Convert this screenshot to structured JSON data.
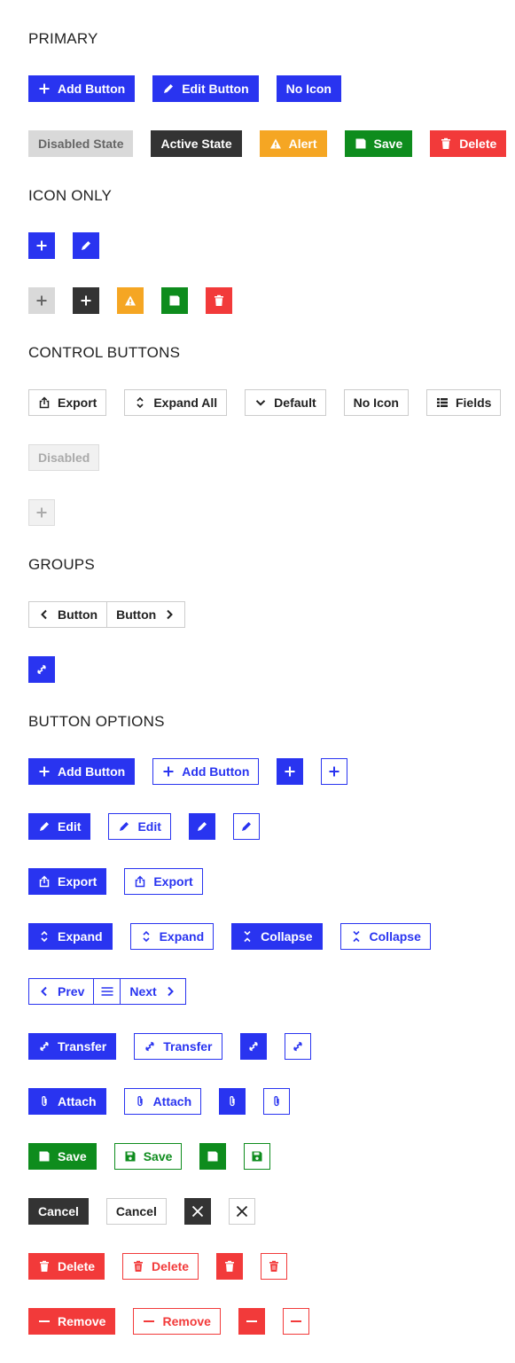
{
  "colors": {
    "primary": "#2934f0",
    "disabled": "#d9d9d9",
    "active": "#333333",
    "alert": "#f5a623",
    "save": "#0e8c1d",
    "delete": "#f23a3a"
  },
  "sections": {
    "primary": "PRIMARY",
    "icon_only": "ICON ONLY",
    "control_buttons": "CONTROL BUTTONS",
    "groups": "GROUPS",
    "button_options": "BUTTON OPTIONS"
  },
  "primary": {
    "add_button": "Add Button",
    "edit_button": "Edit Button",
    "no_icon": "No Icon",
    "disabled_state": "Disabled State",
    "active_state": "Active State",
    "alert": "Alert",
    "save": "Save",
    "delete": "Delete"
  },
  "control": {
    "export": "Export",
    "expand_all": "Expand All",
    "default": "Default",
    "no_icon": "No Icon",
    "fields": "Fields",
    "disabled": "Disabled"
  },
  "groups": {
    "prev_button": "Button",
    "next_button": "Button"
  },
  "options": {
    "add_button": "Add Button",
    "edit": "Edit",
    "export": "Export",
    "expand": "Expand",
    "collapse": "Collapse",
    "prev": "Prev",
    "next": "Next",
    "transfer": "Transfer",
    "attach": "Attach",
    "save": "Save",
    "cancel": "Cancel",
    "delete": "Delete",
    "remove": "Remove"
  },
  "icons": [
    "plus-icon",
    "pencil-icon",
    "warning-icon",
    "floppy-icon",
    "trash-icon",
    "export-icon",
    "expand-icon",
    "collapse-icon",
    "chevron-down-icon",
    "list-icon",
    "chevron-left-icon",
    "chevron-right-icon",
    "menu-icon",
    "transfer-icon",
    "paperclip-icon",
    "close-icon",
    "minus-icon"
  ]
}
